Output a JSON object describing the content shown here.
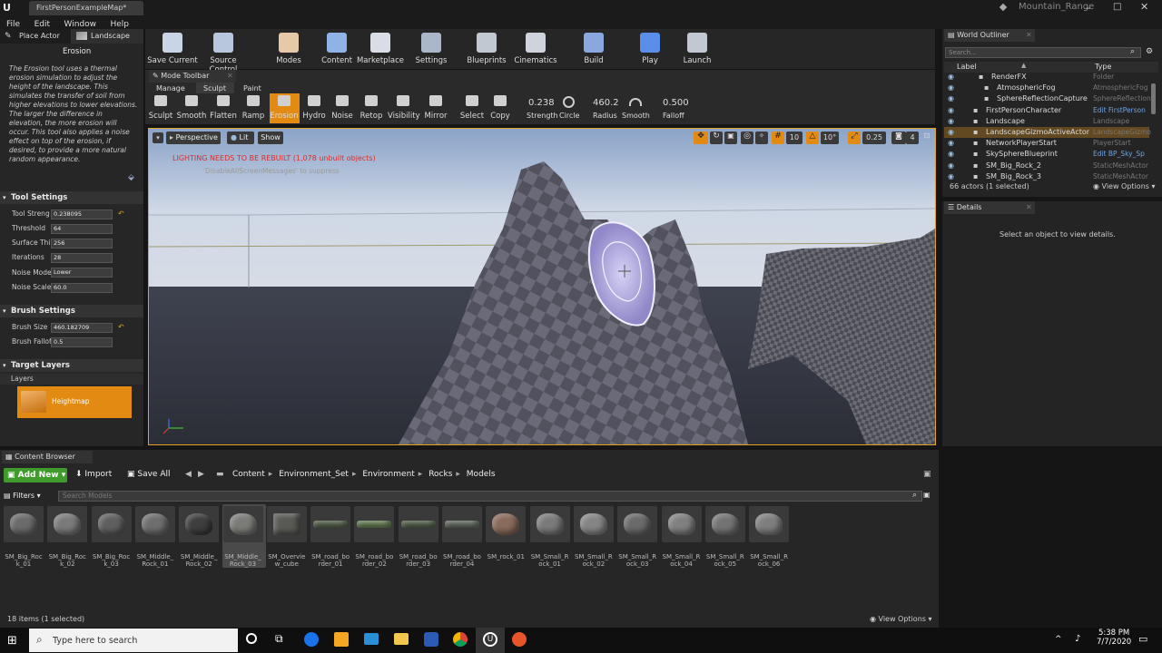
{
  "window": {
    "tab_title": "FirstPersonExampleMap*",
    "project_name": "Mountain_Range"
  },
  "menu": [
    "File",
    "Edit",
    "Window",
    "Help"
  ],
  "mode_tabs": {
    "place_actor": "Place Actor",
    "landscape": "Landscape"
  },
  "toolbar": [
    {
      "label": "Save Current",
      "icon": "save-icon"
    },
    {
      "label": "Source Control",
      "icon": "source-control-icon"
    },
    {
      "label": "Modes",
      "icon": "modes-icon"
    },
    {
      "label": "Content",
      "icon": "content-icon"
    },
    {
      "label": "Marketplace",
      "icon": "marketplace-icon"
    },
    {
      "label": "Settings",
      "icon": "settings-icon"
    },
    {
      "label": "Blueprints",
      "icon": "blueprints-icon"
    },
    {
      "label": "Cinematics",
      "icon": "cinematics-icon"
    },
    {
      "label": "Build",
      "icon": "build-icon"
    },
    {
      "label": "Play",
      "icon": "play-icon"
    },
    {
      "label": "Launch",
      "icon": "launch-icon"
    }
  ],
  "left_panel": {
    "tool_title": "Erosion",
    "description": "The Erosion tool uses a thermal erosion simulation to adjust the height of the landscape. This simulates the transfer of soil from higher elevations to lower elevations. The larger the difference in elevation, the more erosion will occur. This tool also applies a noise effect on top of the erosion, if desired, to provide a more natural random appearance.",
    "tool_settings_header": "Tool Settings",
    "tool_settings": [
      {
        "label": "Tool Streng",
        "value": "0.238095"
      },
      {
        "label": "Threshold",
        "value": "64"
      },
      {
        "label": "Surface Thi",
        "value": "256"
      },
      {
        "label": "Iterations",
        "value": "28"
      },
      {
        "label": "Noise Mode",
        "value": "Lower"
      },
      {
        "label": "Noise Scale",
        "value": "60.0"
      }
    ],
    "brush_settings_header": "Brush Settings",
    "brush_settings": [
      {
        "label": "Brush Size",
        "value": "460.182709"
      },
      {
        "label": "Brush Falloff",
        "value": "0.5"
      }
    ],
    "target_layers_header": "Target Layers",
    "layers_label": "Layers",
    "heightmap_label": "Heightmap"
  },
  "mode_toolbar": {
    "title": "Mode Toolbar",
    "tabs": [
      "Manage",
      "Sculpt",
      "Paint"
    ],
    "tools": [
      "Sculpt",
      "Smooth",
      "Flatten",
      "Ramp",
      "Erosion",
      "Hydro",
      "Noise",
      "Retop",
      "Visibility",
      "Mirror",
      "Select",
      "Copy"
    ],
    "strength_value": "0.238",
    "strength_label": "Strength",
    "circle_label": "Circle",
    "radius_value": "460.2",
    "radius_label": "Radius",
    "smooth_label": "Smooth",
    "falloff_value": "0.500",
    "falloff_label": "Falloff"
  },
  "viewport": {
    "perspective": "Perspective",
    "lit": "Lit",
    "show": "Show",
    "warning": "LIGHTING NEEDS TO BE REBUILT (1,078 unbuilt objects)",
    "suppress_hint": "'DisableAllScreenMessages' to suppress",
    "grid_snap": "10",
    "rot_snap": "10°",
    "scale_snap": "0.25",
    "camera_speed": "4"
  },
  "world_outliner": {
    "title": "World Outliner",
    "search_placeholder": "Search...",
    "col_label": "Label",
    "col_type": "Type",
    "rows": [
      {
        "label": "RenderFX",
        "type": "Folder"
      },
      {
        "label": "AtmosphericFog",
        "type": "AtmosphericFog"
      },
      {
        "label": "SphereReflectionCapture",
        "type": "SphereReflection"
      },
      {
        "label": "FirstPersonCharacter",
        "type": "Edit FirstPerson"
      },
      {
        "label": "Landscape",
        "type": "Landscape"
      },
      {
        "label": "LandscapeGizmoActiveActor",
        "type": "LandscapeGizmo"
      },
      {
        "label": "NetworkPlayerStart",
        "type": "PlayerStart"
      },
      {
        "label": "SkySphereBlueprint",
        "type": "Edit BP_Sky_Sp"
      },
      {
        "label": "SM_Big_Rock_2",
        "type": "StaticMeshActor"
      },
      {
        "label": "SM_Big_Rock_3",
        "type": "StaticMeshActor"
      }
    ],
    "count": "66 actors (1 selected)",
    "view_options": "View Options"
  },
  "details": {
    "title": "Details",
    "empty_message": "Select an object to view details."
  },
  "content_browser": {
    "title": "Content Browser",
    "add_new": "Add New",
    "import": "Import",
    "save_all": "Save All",
    "breadcrumb": [
      "Content",
      "Environment_Set",
      "Environment",
      "Rocks",
      "Models"
    ],
    "filters": "Filters",
    "search_placeholder": "Search Models",
    "assets": [
      "SM_Big_Rock_01",
      "SM_Big_Rock_02",
      "SM_Big_Rock_03",
      "SM_Middle_Rock_01",
      "SM_Middle_Rock_02",
      "SM_Middle_Rock_03",
      "SM_Overview_cube",
      "SM_road_border_01",
      "SM_road_border_02",
      "SM_road_border_03",
      "SM_road_border_04",
      "SM_rock_01",
      "SM_Small_Rock_01",
      "SM_Small_Rock_02",
      "SM_Small_Rock_03",
      "SM_Small_Rock_04",
      "SM_Small_Rock_05",
      "SM_Small_Rock_06"
    ],
    "item_count": "18 items (1 selected)",
    "view_options": "View Options"
  },
  "taskbar": {
    "search_placeholder": "Type here to search",
    "time": "5:38 PM",
    "date": "7/7/2020"
  },
  "colors": {
    "accent": "#e3a221",
    "selected_tool": "#e38a12",
    "warning": "#e02a2a",
    "heightmap": "#e38a12",
    "addnew": "#3f9b2c"
  }
}
